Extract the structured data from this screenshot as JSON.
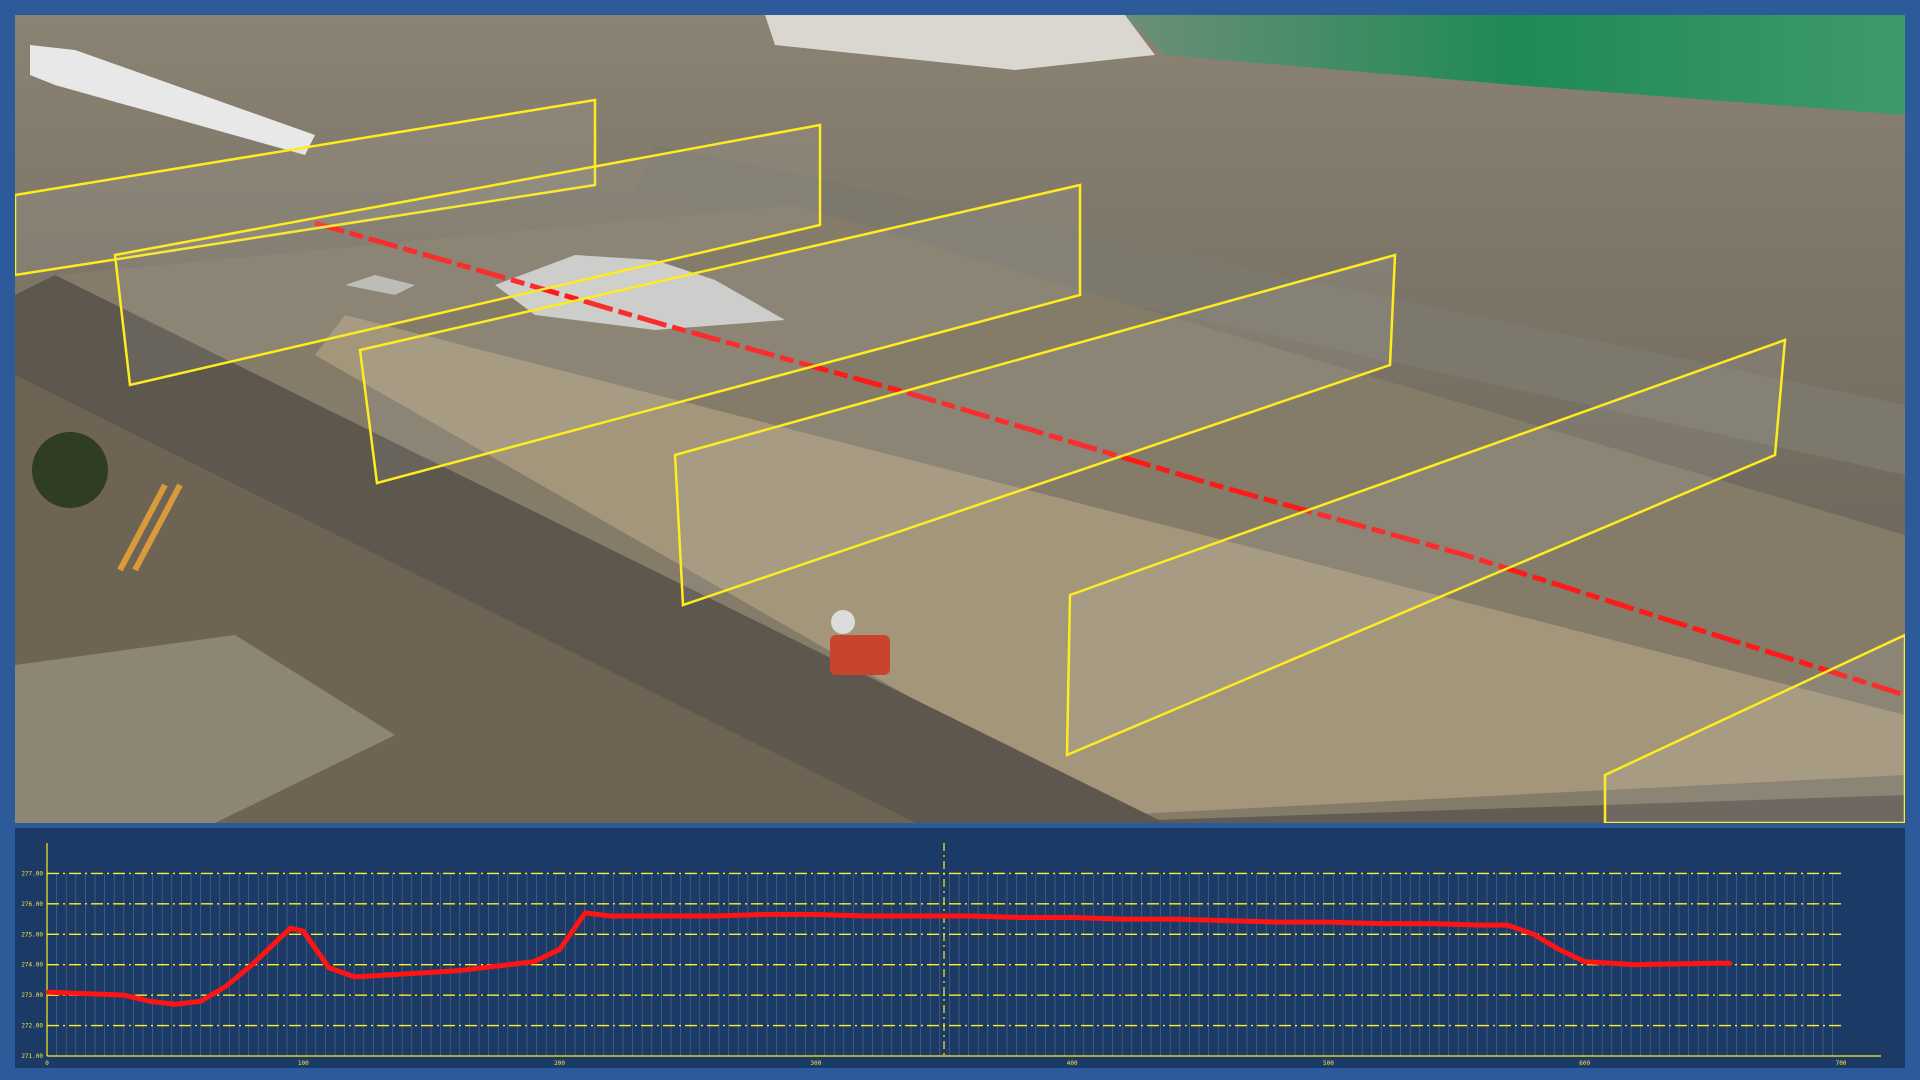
{
  "viewport": {
    "scene": "aerial-construction-site",
    "section_planes": 7,
    "centerline_color": "#ff1a1a",
    "plane_color": "#ffec1f"
  },
  "profile": {
    "background": "#1c3a66",
    "grid_color": "#ffee22",
    "y_tick_labels": [
      "",
      "277.00",
      "276.00",
      "275.00",
      "274.00",
      "273.00",
      "272.00",
      "271.00"
    ],
    "x_tick_labels": [
      "0",
      "100",
      "200",
      "300",
      "400",
      "500",
      "600",
      "700"
    ],
    "chart_data": {
      "type": "line",
      "xlabel": "",
      "ylabel": "",
      "series": [
        {
          "x": [
            0,
            30,
            40,
            50,
            60,
            70,
            80,
            90,
            95,
            100,
            110,
            120,
            130,
            140,
            150,
            160,
            170,
            180,
            190,
            200,
            205,
            210,
            220,
            240,
            260,
            280,
            300,
            320,
            340,
            360,
            380,
            400,
            420,
            440,
            460,
            480,
            500,
            520,
            540,
            560,
            570,
            580,
            590,
            600,
            620,
            650,
            657
          ],
          "y": [
            273.1,
            273.0,
            272.8,
            272.7,
            272.8,
            273.3,
            274.0,
            274.8,
            275.2,
            275.1,
            273.9,
            273.6,
            273.65,
            273.7,
            273.75,
            273.8,
            273.9,
            274.0,
            274.1,
            274.5,
            275.1,
            275.7,
            275.6,
            275.6,
            275.6,
            275.65,
            275.65,
            275.6,
            275.6,
            275.6,
            275.55,
            275.55,
            275.5,
            275.5,
            275.45,
            275.4,
            275.4,
            275.35,
            275.35,
            275.3,
            275.3,
            275.0,
            274.5,
            274.1,
            274.0,
            274.05,
            274.05
          ]
        }
      ],
      "xlim": [
        0,
        700
      ],
      "ylim": [
        271,
        278
      ],
      "grid": true
    }
  }
}
